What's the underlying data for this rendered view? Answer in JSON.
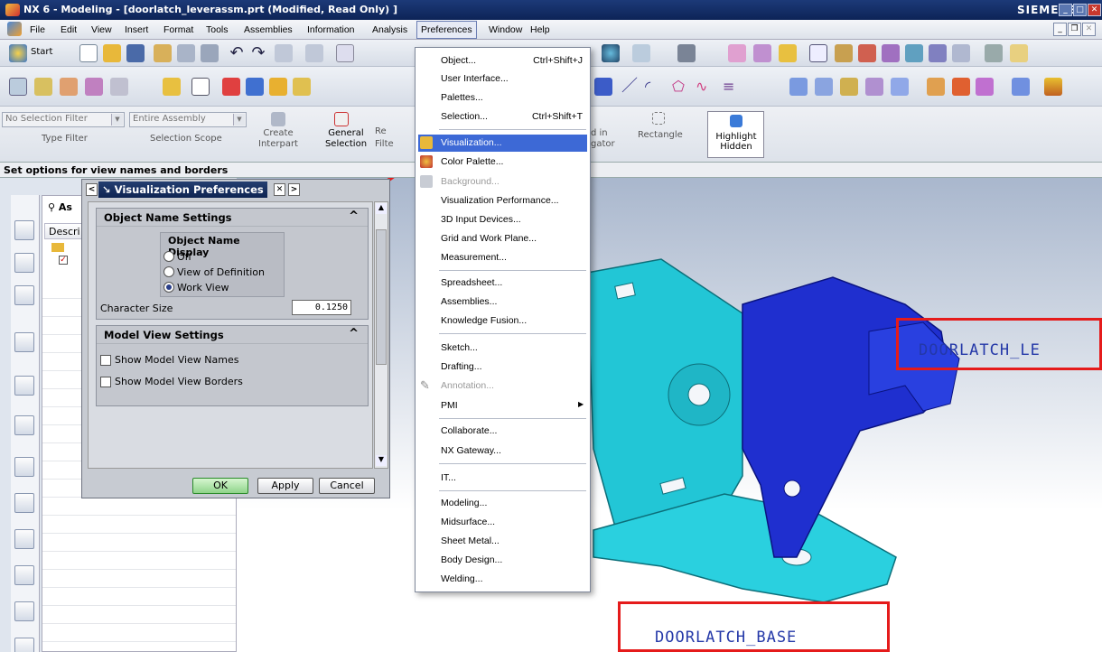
{
  "window": {
    "title": "NX 6 - Modeling - [doorlatch_leverassm.prt (Modified, Read Only) ]",
    "brand": "SIEMENS"
  },
  "menubar": {
    "items": [
      "File",
      "Edit",
      "View",
      "Insert",
      "Format",
      "Tools",
      "Assemblies",
      "Information",
      "Analysis",
      "Preferences",
      "Window",
      "Help"
    ]
  },
  "toolbar": {
    "start_label": "Start"
  },
  "ribbon": {
    "filter_combo": "No Selection Filter",
    "scope_combo": "Entire Assembly",
    "type_filter_label": "Type Filter",
    "selection_scope_label": "Selection Scope",
    "create_interpart_label": "Create Interpart",
    "general_selection_label": "General Selection",
    "rectangle_label": "Rectangle",
    "highlight_hidden_label": "Highlight Hidden",
    "frag_filter": "Filte",
    "frag_navigator": "gator",
    "frag_din": "d in",
    "frag_res": "Re"
  },
  "statusbar": {
    "message": "Set options for view names and borders"
  },
  "navigator": {
    "tab_label": "As",
    "column_label": "Descri"
  },
  "dialog": {
    "title": "Visualization Preferences",
    "group1_title": "Object Name Settings",
    "subgroup_title": "Object Name Display",
    "radio_off": "Off",
    "radio_view_def": "View of Definition",
    "radio_work_view": "Work View",
    "char_size_label": "Character Size",
    "char_size_value": "0.1250",
    "group2_title": "Model View Settings",
    "check_names": "Show Model View Names",
    "check_borders": "Show Model View Borders",
    "ok_label": "OK",
    "apply_label": "Apply",
    "cancel_label": "Cancel"
  },
  "preferences_menu": {
    "items": [
      {
        "label": "Object...",
        "shortcut": "Ctrl+Shift+J"
      },
      {
        "label": "User Interface..."
      },
      {
        "label": "Palettes..."
      },
      {
        "label": "Selection...",
        "shortcut": "Ctrl+Shift+T"
      },
      {
        "label": "Visualization..."
      },
      {
        "label": "Color Palette..."
      },
      {
        "label": "Background..."
      },
      {
        "label": "Visualization Performance..."
      },
      {
        "label": "3D Input Devices..."
      },
      {
        "label": "Grid and Work Plane..."
      },
      {
        "label": "Measurement..."
      },
      {
        "label": "Spreadsheet..."
      },
      {
        "label": "Assemblies..."
      },
      {
        "label": "Knowledge Fusion..."
      },
      {
        "label": "Sketch..."
      },
      {
        "label": "Drafting..."
      },
      {
        "label": "Annotation..."
      },
      {
        "label": "PMI"
      },
      {
        "label": "Collaborate..."
      },
      {
        "label": "NX Gateway..."
      },
      {
        "label": "IT..."
      },
      {
        "label": "Modeling..."
      },
      {
        "label": "Midsurface..."
      },
      {
        "label": "Sheet Metal..."
      },
      {
        "label": "Body Design..."
      },
      {
        "label": "Welding..."
      }
    ]
  },
  "model": {
    "label_lever": "DOORLATCH_LE",
    "label_base": "DOORLATCH_BASE",
    "colors": {
      "cyan_part": "#22c6d6",
      "blue_part": "#1f2fcf",
      "annotation_red": "#e51b1b"
    }
  }
}
